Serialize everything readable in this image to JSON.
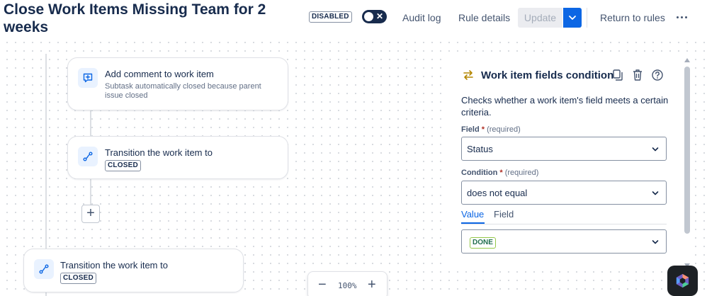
{
  "header": {
    "title": "Close Work Items Missing Team for 2 weeks",
    "status_lozenge": "DISABLED",
    "toggle_on": false,
    "audit_log_label": "Audit log",
    "rule_details_label": "Rule details",
    "update_label": "Update",
    "return_label": "Return to rules"
  },
  "flow": {
    "cards": [
      {
        "title": "Add comment to work item",
        "subtitle": "Subtask automatically closed because parent issue closed",
        "icon": "comment-add-icon"
      },
      {
        "title": "Transition the work item to",
        "status": "CLOSED",
        "icon": "transition-icon"
      },
      {
        "title": "Transition the work item to",
        "status": "CLOSED",
        "icon": "transition-icon"
      }
    ]
  },
  "zoom": {
    "value": "100%"
  },
  "panel": {
    "title": "Work item fields condition",
    "description": "Checks whether a work item's field meets a certain criteria.",
    "field": {
      "label": "Field",
      "required_mark": "*",
      "hint": "(required)",
      "value": "Status"
    },
    "condition": {
      "label": "Condition",
      "required_mark": "*",
      "hint": "(required)",
      "value": "does not equal"
    },
    "tabs": [
      "Value",
      "Field"
    ],
    "active_tab": "Value",
    "value": "DONE"
  },
  "colors": {
    "accent": "#0c66e4",
    "text": "#172b4d",
    "done_border": "#94c748"
  }
}
